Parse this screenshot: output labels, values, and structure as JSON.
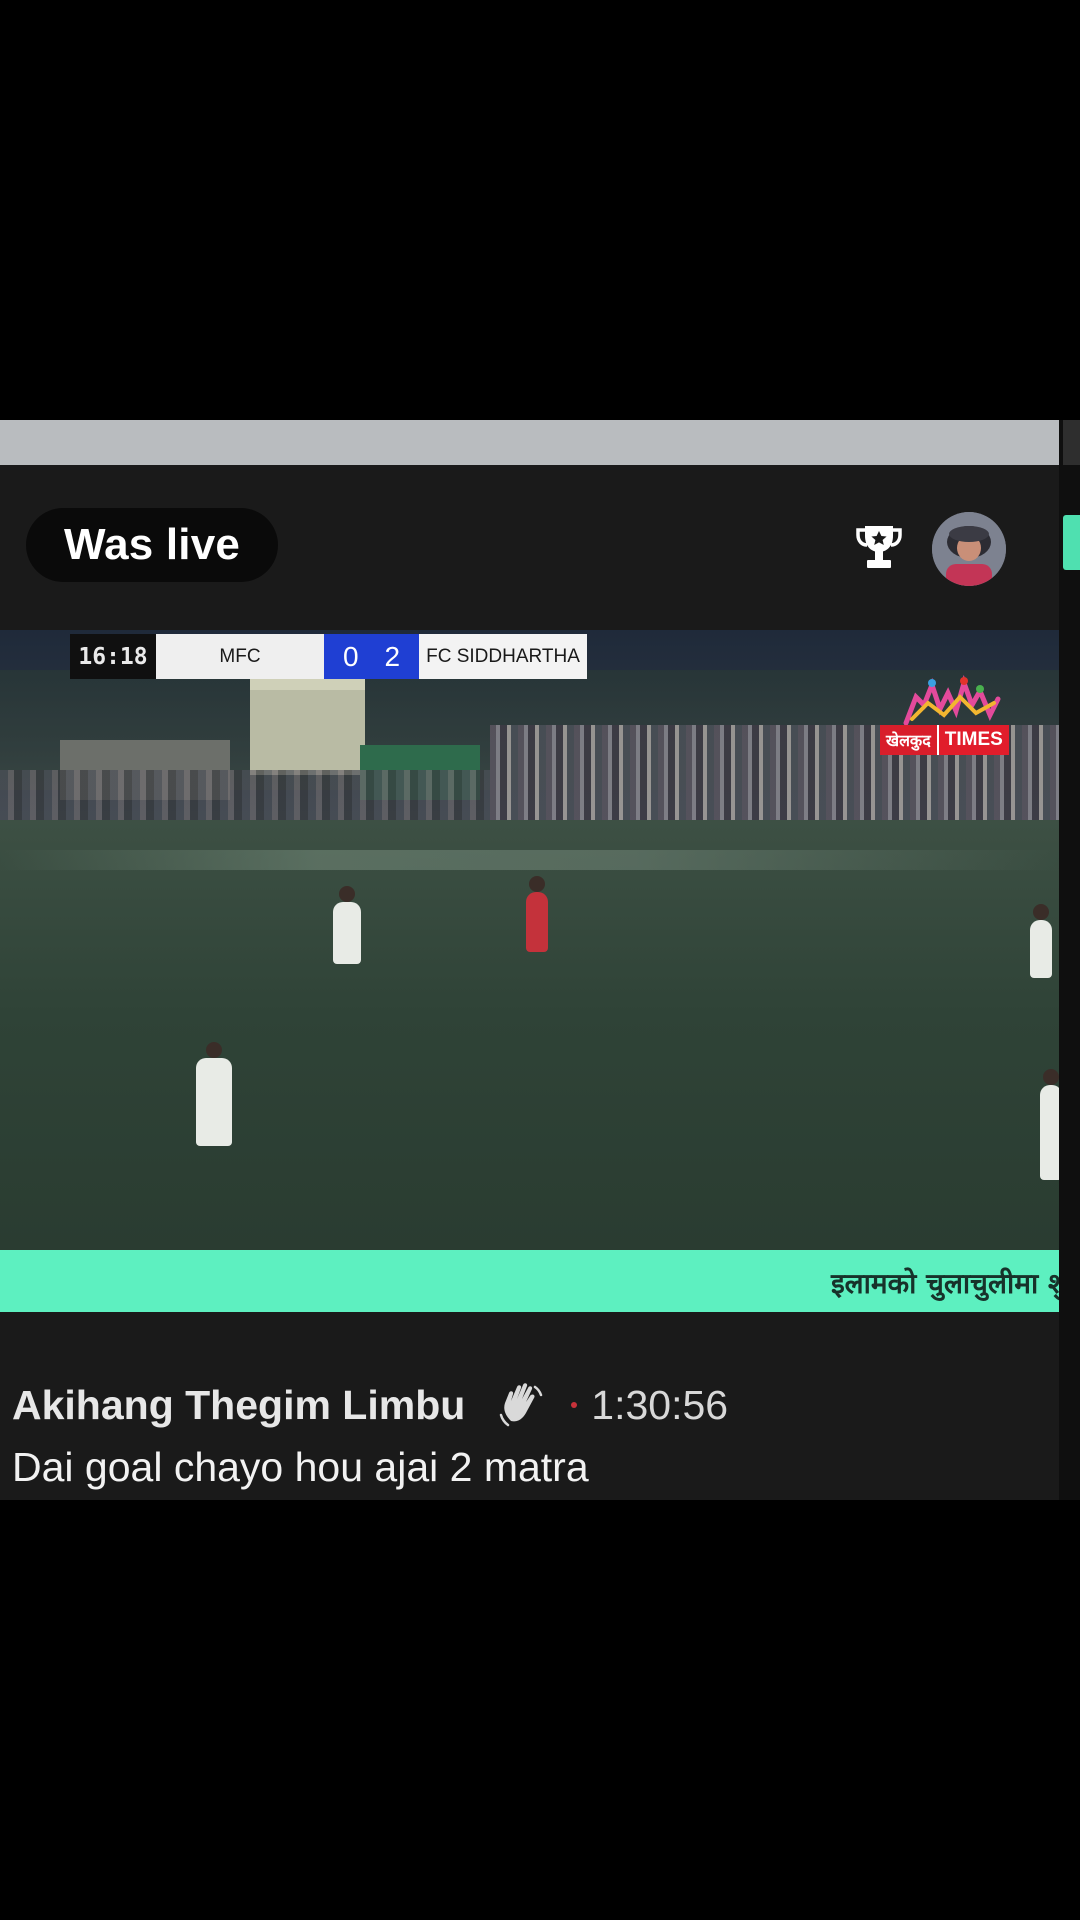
{
  "stream": {
    "status_label": "Was live"
  },
  "scoreboard": {
    "clock": "16:18",
    "home_team": "MFC",
    "home_score": "0",
    "away_score": "2",
    "away_team": "FC SIDDHARTHA"
  },
  "broadcaster": {
    "logo_text_left": "खेलकुद",
    "logo_text_right": "TIMES"
  },
  "ticker": {
    "text": "इलामको चुलाचुलीमा शु"
  },
  "comment": {
    "author": "Akihang Thegim Limbu",
    "timestamp": "1:30:56",
    "text": "Dai goal chayo hou ajai 2 matra"
  },
  "icons": {
    "trophy": "trophy-icon",
    "wave": "waving-hand-icon",
    "avatar": "avatar"
  },
  "colors": {
    "ticker_bg": "#5df0c0",
    "score_bg": "#1f3fd3",
    "brand_red": "#e11d2b"
  }
}
